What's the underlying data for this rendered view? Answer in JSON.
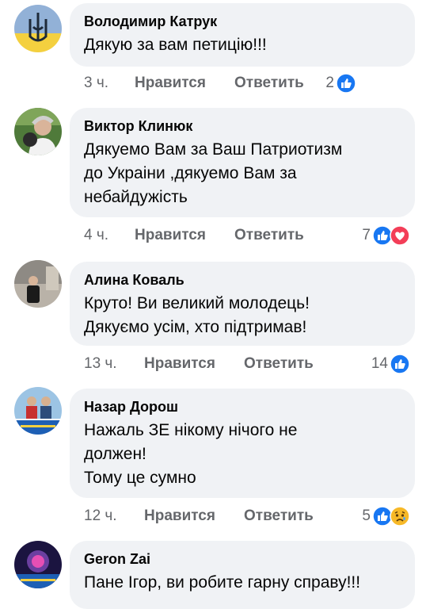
{
  "comments": [
    {
      "author": "Володимир Катрук",
      "text": [
        "Дякую за вам петицію!!!"
      ],
      "time": "3 ч.",
      "like": "Нравится",
      "reply": "Ответить",
      "reaction_count": "2",
      "reactions": [
        "like-icon"
      ]
    },
    {
      "author": "Виктор Клинюк",
      "text": [
        "Дякуемо Вам за Ваш Патриотизм",
        "до Украіни ,дякуемо Вам за",
        "небайдужість"
      ],
      "time": "4 ч.",
      "like": "Нравится",
      "reply": "Ответить",
      "reaction_count": "7",
      "reactions": [
        "like-icon",
        "love-icon"
      ]
    },
    {
      "author": "Алина Коваль",
      "text": [
        "Круто! Ви великий молодець!",
        "Дякуємо усім, хто підтримав!"
      ],
      "time": "13 ч.",
      "like": "Нравится",
      "reply": "Ответить",
      "reaction_count": "14",
      "reactions": [
        "like-icon"
      ]
    },
    {
      "author": "Назар Дорош",
      "text": [
        "Нажаль ЗЕ нікому нічого не",
        "должен!",
        "Тому це сумно"
      ],
      "time": "12 ч.",
      "like": "Нравится",
      "reply": "Ответить",
      "reaction_count": "5",
      "reactions": [
        "like-icon",
        "sad-icon"
      ]
    },
    {
      "author": "Geron Zai",
      "text": [
        "Пане Ігор, ви робите гарну справу!!!"
      ]
    }
  ],
  "colors": {
    "bubble": "#f0f2f5",
    "like_blue": "#1877f2",
    "love_red": "#f33e58",
    "sad_yellow": "#f7b928",
    "meta_gray": "#65676b"
  }
}
